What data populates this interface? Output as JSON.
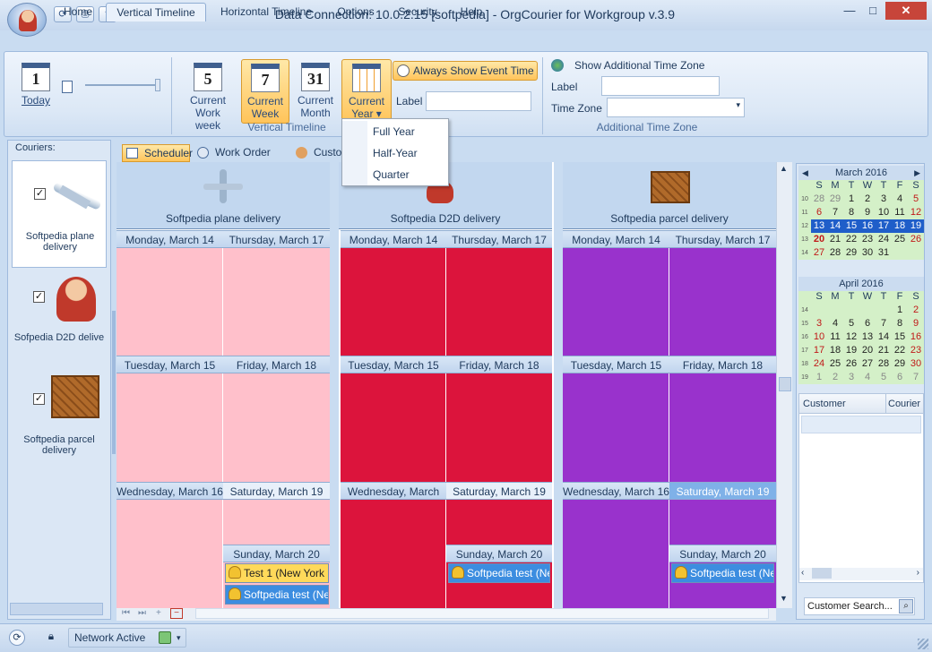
{
  "window": {
    "title": "Data Connection: 10.0.2.15 [softpedia] - OrgCourier for Workgroup v.3.9",
    "controls": {
      "minimize": "—",
      "maximize": "□",
      "close": "✕"
    }
  },
  "quick_access": {
    "icons": [
      "refresh-icon",
      "print-icon",
      "help-icon"
    ],
    "more": "▾"
  },
  "tabs": [
    {
      "label": "Home"
    },
    {
      "label": "Vertical Timeline",
      "active": true
    },
    {
      "label": "Horizontal Timeline"
    },
    {
      "label": "Options"
    },
    {
      "label": "Security"
    },
    {
      "label": "Help"
    }
  ],
  "ribbon": {
    "today": {
      "number": "1",
      "label": "Today"
    },
    "views": [
      {
        "number": "5",
        "label1": "Current",
        "label2": "Work week"
      },
      {
        "number": "7",
        "label1": "Current",
        "label2": "Week",
        "selected": true
      },
      {
        "number": "31",
        "label1": "Current",
        "label2": "Month"
      },
      {
        "number": "",
        "label1": "Current",
        "label2": "Year ▾",
        "selected": true
      }
    ],
    "always_show_event_time": "Always Show Event Time",
    "label_field": {
      "label": "Label",
      "value": ""
    },
    "group_vertical_timeline": "Vertical Timeline",
    "time_zone": {
      "show_label": "Show Additional Time Zone",
      "label": "Label",
      "label_value": "",
      "time_zone": "Time Zone",
      "time_zone_value": "",
      "group": "Additional Time Zone"
    }
  },
  "year_menu": {
    "items": [
      "Full Year",
      "Half-Year",
      "Quarter"
    ]
  },
  "couriers": {
    "header": "Couriers:",
    "items": [
      {
        "name": "Softpedia plane delivery",
        "checked": true
      },
      {
        "name": "Sofpedia D2D delive",
        "checked": true
      },
      {
        "name": "Softpedia parcel delivery",
        "checked": true
      }
    ]
  },
  "scheduler_tabs": [
    "Scheduler",
    "Work Order List",
    "Custo"
  ],
  "resources": [
    {
      "name": "Softpedia plane delivery",
      "color": "#ffc0cb"
    },
    {
      "name": "Softpedia D2D delivery",
      "color": "#dc143c"
    },
    {
      "name": "Softpedia parcel delivery",
      "color": "#9932cc"
    }
  ],
  "days": {
    "left": [
      "Monday, March 14",
      "Tuesday, March 15",
      "Wednesday, March 16"
    ],
    "right": [
      "Thursday, March 17",
      "Friday, March 18",
      "Saturday, March 19",
      "Sunday, March 20"
    ]
  },
  "appointments": {
    "plane": [
      {
        "text": "Test 1 (New York C",
        "style": "yellow"
      },
      {
        "text": "Softpedia test (New",
        "style": "blue"
      }
    ],
    "d2d": [
      {
        "text": "Softpedia test (Ne\u0000",
        "style": "blue"
      }
    ],
    "parcel": [
      {
        "text": "Softpedia test (Ne\u0000",
        "style": "blue"
      }
    ]
  },
  "calendars": [
    {
      "title": "March 2016",
      "weekdays": [
        "S",
        "M",
        "T",
        "W",
        "T",
        "F",
        "S"
      ],
      "weeks": [
        {
          "n": "10",
          "days": [
            "28",
            "29",
            "1",
            "2",
            "3",
            "4",
            "5"
          ]
        },
        {
          "n": "11",
          "days": [
            "6",
            "7",
            "8",
            "9",
            "10",
            "11",
            "12"
          ]
        },
        {
          "n": "12",
          "days": [
            "13",
            "14",
            "15",
            "16",
            "17",
            "18",
            "19"
          ]
        },
        {
          "n": "13",
          "days": [
            "20",
            "21",
            "22",
            "23",
            "24",
            "25",
            "26"
          ]
        },
        {
          "n": "14",
          "days": [
            "27",
            "28",
            "29",
            "30",
            "31",
            "",
            ""
          ]
        }
      ]
    },
    {
      "title": "April 2016",
      "weekdays": [
        "S",
        "M",
        "T",
        "W",
        "T",
        "F",
        "S"
      ],
      "weeks": [
        {
          "n": "14",
          "days": [
            "",
            "",
            "",
            "",
            "",
            "1",
            "2"
          ]
        },
        {
          "n": "15",
          "days": [
            "3",
            "4",
            "5",
            "6",
            "7",
            "8",
            "9"
          ]
        },
        {
          "n": "16",
          "days": [
            "10",
            "11",
            "12",
            "13",
            "14",
            "15",
            "16"
          ]
        },
        {
          "n": "17",
          "days": [
            "17",
            "18",
            "19",
            "20",
            "21",
            "22",
            "23"
          ]
        },
        {
          "n": "18",
          "days": [
            "24",
            "25",
            "26",
            "27",
            "28",
            "29",
            "30"
          ]
        },
        {
          "n": "19",
          "days": [
            "1",
            "2",
            "3",
            "4",
            "5",
            "6",
            "7"
          ]
        }
      ]
    }
  ],
  "customer_grid": {
    "columns": [
      "Customer",
      "Courier"
    ]
  },
  "customer_search": {
    "label": "Customer Search..."
  },
  "status": {
    "network": "Network Active"
  }
}
